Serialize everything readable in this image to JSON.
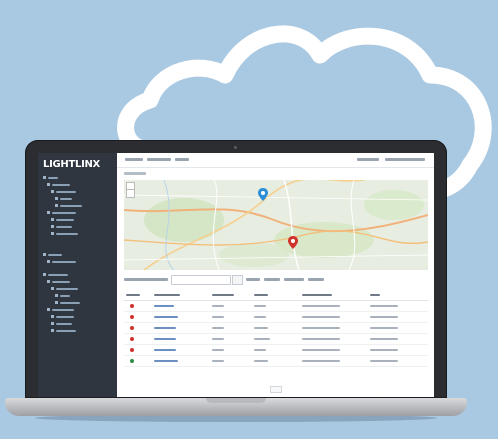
{
  "app": {
    "logo_text": "LIGHTLINX",
    "brand_color": "#2f3640"
  },
  "map": {
    "markers": [
      {
        "name": "blue-pin",
        "color": "#2a8fd6"
      },
      {
        "name": "red-pin",
        "color": "#d0342c"
      }
    ]
  },
  "table": {
    "rows": [
      {
        "status_color": "#d0342c"
      },
      {
        "status_color": "#d0342c"
      },
      {
        "status_color": "#d0342c"
      },
      {
        "status_color": "#d0342c"
      },
      {
        "status_color": "#d0342c"
      },
      {
        "status_color": "#2f8f46"
      }
    ]
  },
  "colors": {
    "background": "#a9c8e2",
    "cloud": "#ffffff",
    "laptop_body": "#2c2d31"
  }
}
